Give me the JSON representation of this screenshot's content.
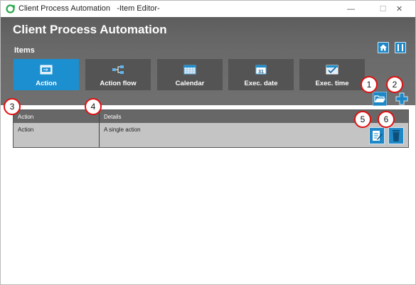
{
  "window": {
    "title": "Client Process Automation",
    "subtitle": "-Item Editor-",
    "minimize_label": "—",
    "maximize_label": "☐",
    "close_label": "✕"
  },
  "header": {
    "app_title": "Client Process Automation",
    "section_label": "Items",
    "accent": "#1b8fd0"
  },
  "tiles": [
    {
      "label": "Action",
      "icon": "action-icon",
      "active": true
    },
    {
      "label": "Action flow",
      "icon": "flow-icon",
      "active": false
    },
    {
      "label": "Calendar",
      "icon": "calendar-icon",
      "active": false
    },
    {
      "label": "Exec. date",
      "icon": "exec-date-icon",
      "date_number": "31",
      "active": false
    },
    {
      "label": "Exec. time",
      "icon": "exec-time-icon",
      "active": false
    }
  ],
  "callouts": [
    "1",
    "2",
    "3",
    "4",
    "5",
    "6"
  ],
  "grid": {
    "columns": [
      "Action",
      "Details"
    ],
    "rows": [
      {
        "action": "Action",
        "details": "A single action"
      }
    ]
  }
}
